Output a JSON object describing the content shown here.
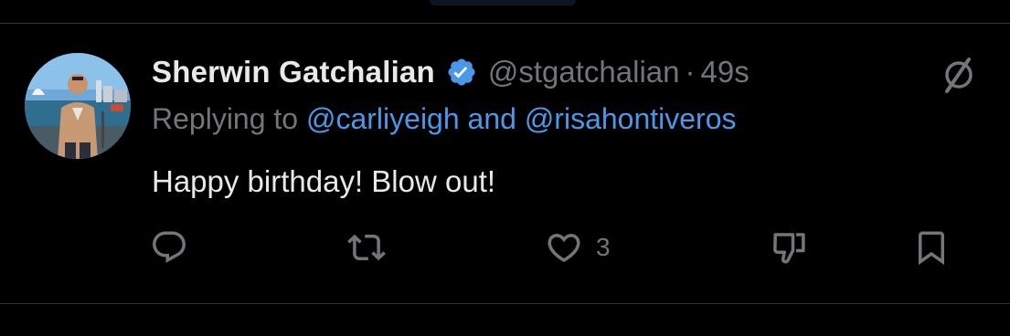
{
  "tweet": {
    "author_name": "Sherwin Gatchalian",
    "handle": "@stgatchalian",
    "separator": "·",
    "time": "49s",
    "replying_label": "Replying to",
    "reply_mention_1": "@carliyeigh",
    "reply_and": "and",
    "reply_mention_2": "@risahontiveros",
    "text": "Happy birthday! Blow out!",
    "verified_icon": "verified-badge-icon",
    "menu_icon": "grok-icon"
  },
  "actions": {
    "reply_icon": "reply-icon",
    "repost_icon": "repost-icon",
    "like_icon": "like-icon",
    "like_count": "3",
    "dislike_icon": "dislike-icon",
    "bookmark_icon": "bookmark-icon"
  },
  "colors": {
    "background": "#000000",
    "primary_text": "#e7e9ea",
    "secondary_text": "#71767b",
    "link": "#4a99e9",
    "verified": "#4a99e9",
    "divider": "#2f3336"
  }
}
